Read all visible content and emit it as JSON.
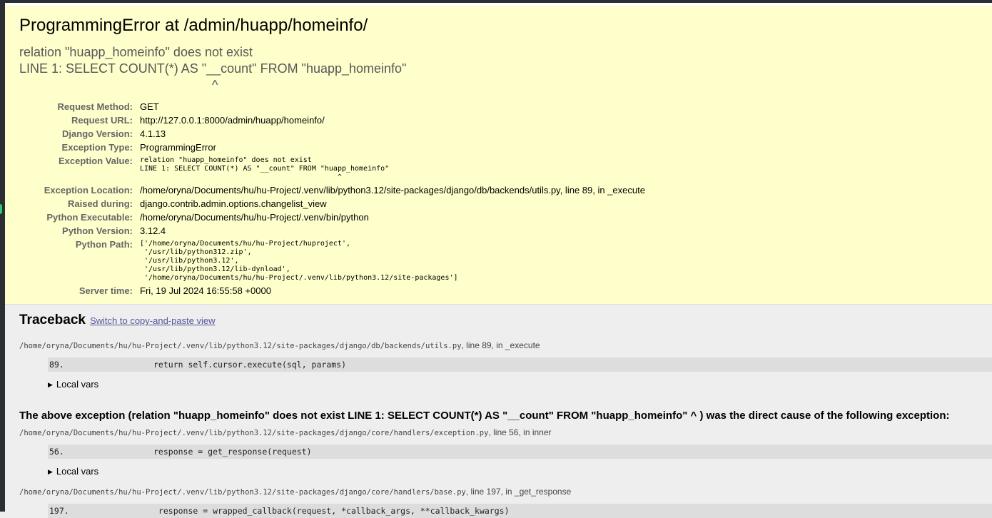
{
  "summary": {
    "title": "ProgrammingError at /admin/huapp/homeinfo/",
    "exception_message": "relation \"huapp_homeinfo\" does not exist\nLINE 1: SELECT COUNT(*) AS \"__count\" FROM \"huapp_homeinfo\"\n                                                      ^",
    "meta": [
      {
        "label": "Request Method:",
        "value": "GET"
      },
      {
        "label": "Request URL:",
        "value": "http://127.0.0.1:8000/admin/huapp/homeinfo/"
      },
      {
        "label": "Django Version:",
        "value": "4.1.13"
      },
      {
        "label": "Exception Type:",
        "value": "ProgrammingError"
      },
      {
        "label": "Exception Value:",
        "value": "relation \"huapp_homeinfo\" does not exist\nLINE 1: SELECT COUNT(*) AS \"__count\" FROM \"huapp_homeinfo\"\n                                              ^"
      },
      {
        "label": "Exception Location:",
        "value": "/home/oryna/Documents/hu/hu-Project/.venv/lib/python3.12/site-packages/django/db/backends/utils.py, line 89, in _execute"
      },
      {
        "label": "Raised during:",
        "value": "django.contrib.admin.options.changelist_view"
      },
      {
        "label": "Python Executable:",
        "value": "/home/oryna/Documents/hu/hu-Project/.venv/bin/python"
      },
      {
        "label": "Python Version:",
        "value": "3.12.4"
      },
      {
        "label": "Python Path:",
        "value": "['/home/oryna/Documents/hu/hu-Project/huproject',\n '/usr/lib/python312.zip',\n '/usr/lib/python3.12',\n '/usr/lib/python3.12/lib-dynload',\n '/home/oryna/Documents/hu/hu-Project/.venv/lib/python3.12/site-packages']"
      },
      {
        "label": "Server time:",
        "value": "Fri, 19 Jul 2024 16:55:58 +0000"
      }
    ]
  },
  "traceback": {
    "heading": "Traceback",
    "switch_link": "Switch to copy-and-paste view",
    "local_vars_label": "Local vars",
    "cause_text": "The above exception (relation \"huapp_homeinfo\" does not exist LINE 1: SELECT COUNT(*) AS \"__count\" FROM \"huapp_homeinfo\" ^ ) was the direct cause of the following exception:",
    "frames": [
      {
        "file": "/home/oryna/Documents/hu/hu-Project/.venv/lib/python3.12/site-packages/django/db/backends/utils.py",
        "location": ", line 89, in _execute",
        "line_no": "89.",
        "code": "return self.cursor.execute(sql, params)"
      },
      {
        "file": "/home/oryna/Documents/hu/hu-Project/.venv/lib/python3.12/site-packages/django/core/handlers/exception.py",
        "location": ", line 56, in inner",
        "line_no": "56.",
        "code": "response = get_response(request)"
      },
      {
        "file": "/home/oryna/Documents/hu/hu-Project/.venv/lib/python3.12/site-packages/django/core/handlers/base.py",
        "location": ", line 197, in _get_response",
        "line_no": "197.",
        "code": " response = wrapped_callback(request, *callback_args, **callback_kwargs)"
      }
    ]
  }
}
